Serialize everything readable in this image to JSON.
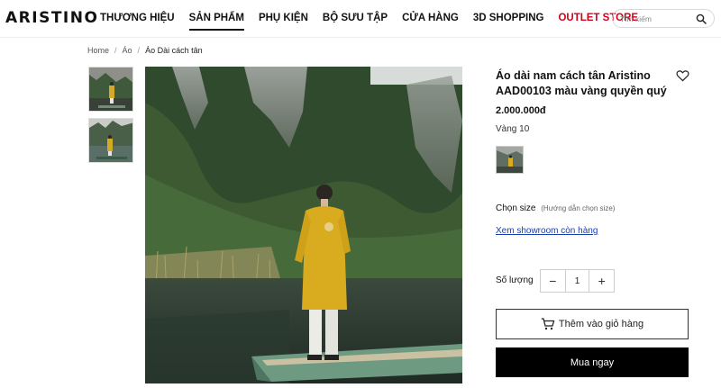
{
  "brand": {
    "logo": "ARISTINO"
  },
  "nav": {
    "items": [
      {
        "label": "THƯƠNG HIỆU"
      },
      {
        "label": "SẢN PHẨM"
      },
      {
        "label": "PHỤ KIỆN"
      },
      {
        "label": "BỘ SƯU TẬP"
      },
      {
        "label": "CỬA HÀNG"
      },
      {
        "label": "3D SHOPPING"
      },
      {
        "label": "OUTLET STORE"
      }
    ],
    "active_item": "SẢN PHẨM"
  },
  "search": {
    "placeholder": "Tìm kiếm",
    "icon": "search-icon"
  },
  "breadcrumb": [
    "Home",
    "Áo",
    "Áo Dài cách tân"
  ],
  "product": {
    "title": "Áo dài nam cách tân Aristino AAD00103 màu vàng quyền quý",
    "price": "2.000.000đ",
    "color": "Vàng 10",
    "size_label": "Chọn size",
    "size_guide": "(Hướng dẫn chọn size)",
    "showroom_link": "Xem showroom còn hàng",
    "quantity_label": "Số lượng",
    "quantity": "1",
    "minus": "−",
    "plus": "+",
    "add_to_cart": "Thêm vào giỏ hàng",
    "buy_now": "Mua ngay"
  },
  "colors": {
    "outlet": "#d0021b",
    "buy_button": "#000000",
    "link": "#1a3fa8"
  },
  "icons": [
    "search-icon",
    "heart-icon",
    "cart-icon",
    "chevron-right-icon"
  ]
}
